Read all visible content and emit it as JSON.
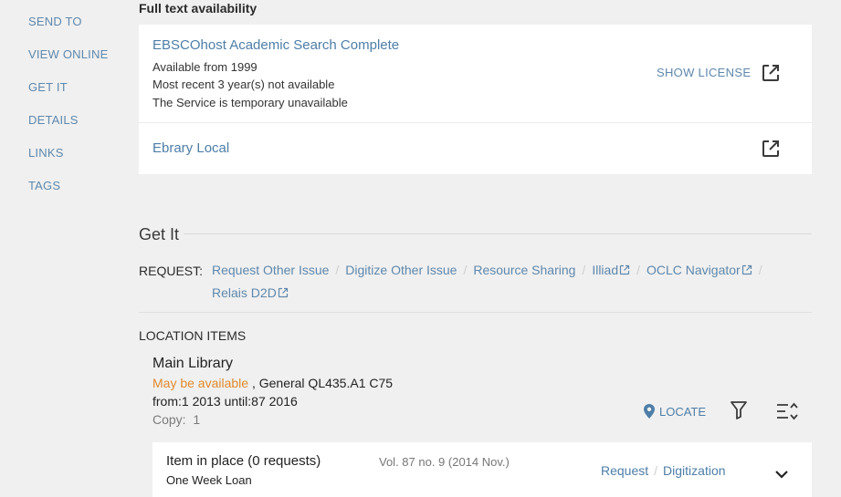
{
  "sidebar": {
    "items": [
      {
        "label": "SEND TO"
      },
      {
        "label": "VIEW ONLINE"
      },
      {
        "label": "GET IT"
      },
      {
        "label": "DETAILS"
      },
      {
        "label": "LINKS"
      },
      {
        "label": "TAGS"
      }
    ]
  },
  "fulltext": {
    "heading": "Full text availability",
    "services": [
      {
        "title": "EBSCOhost Academic Search Complete",
        "lines": [
          "Available from 1999",
          "Most recent 3 year(s) not available",
          "The Service is temporary unavailable"
        ],
        "license_label": "SHOW LICENSE",
        "icon": "external-link-icon"
      },
      {
        "title": "Ebrary Local",
        "icon": "external-link-icon"
      }
    ]
  },
  "getit": {
    "heading": "Get It",
    "request_label": "REQUEST:",
    "request_links": [
      {
        "label": "Request Other Issue"
      },
      {
        "label": "Digitize Other Issue"
      },
      {
        "label": "Resource Sharing"
      },
      {
        "label": "Illiad",
        "external": true
      },
      {
        "label": "OCLC Navigator",
        "external": true
      },
      {
        "label": "Relais D2D",
        "external": true
      }
    ],
    "location_heading": "LOCATION ITEMS",
    "location": {
      "library": "Main Library",
      "availability": "May be available",
      "call_number": " , General QL435.A1 C75",
      "range": "from:1 2013 until:87 2016",
      "copy_label": "Copy:",
      "copy_value": "1",
      "locate_label": "LOCATE",
      "locate_icon": "map-pin-icon",
      "filter_icon": "filter-icon",
      "sort_icon": "sort-icon"
    },
    "item": {
      "status": "Item in place (0 requests)",
      "loan": "One Week Loan",
      "volume": "Vol. 87 no. 9 (2014 Nov.)",
      "request_label": "Request",
      "digitization_label": "Digitization",
      "expand_icon": "chevron-down-icon"
    }
  },
  "colors": {
    "link": "#4d7ea8",
    "availability": "#e08a2e",
    "background": "#f0f0f0"
  }
}
